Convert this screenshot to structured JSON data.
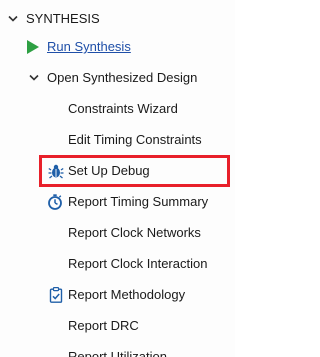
{
  "flow": {
    "section_title": "SYNTHESIS",
    "run_synthesis": "Run Synthesis",
    "open_design": "Open Synthesized Design",
    "items": [
      {
        "label": "Constraints Wizard"
      },
      {
        "label": "Edit Timing Constraints"
      },
      {
        "label": "Set Up Debug"
      },
      {
        "label": "Report Timing Summary"
      },
      {
        "label": "Report Clock Networks"
      },
      {
        "label": "Report Clock Interaction"
      },
      {
        "label": "Report Methodology"
      },
      {
        "label": "Report DRC"
      },
      {
        "label": "Report Utilization"
      }
    ]
  },
  "colors": {
    "run_arrow": "#2ea043",
    "link": "#1f4fa8",
    "highlight": "#e8202a",
    "icon_blue": "#1f5fa8"
  },
  "icons": {
    "section_toggle": "chevron-down-icon",
    "run": "play-icon",
    "open_toggle": "chevron-down-icon",
    "debug": "bug-icon",
    "timing": "stopwatch-icon",
    "methodology": "clipboard-check-icon"
  }
}
